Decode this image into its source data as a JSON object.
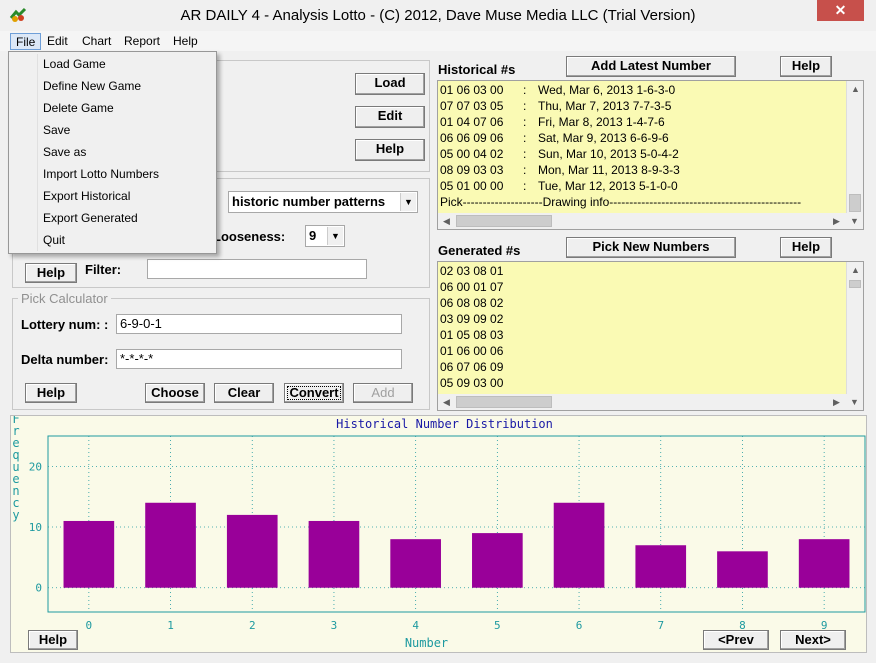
{
  "window": {
    "title": "AR DAILY 4 - Analysis Lotto - (C) 2012, Dave Muse Media LLC (Trial Version)",
    "close_glyph": "✕"
  },
  "menubar": {
    "items": [
      "File",
      "Edit",
      "Chart",
      "Report",
      "Help"
    ]
  },
  "file_menu": {
    "items": [
      "Load Game",
      "Define New Game",
      "Delete Game",
      "Save",
      "Save as",
      "Import Lotto Numbers",
      "Export Historical",
      "Export Generated",
      "Quit"
    ]
  },
  "game_panel": {
    "load_label": "Load",
    "edit_label": "Edit",
    "help_label": "Help"
  },
  "pattern_panel": {
    "pattern_value": "historic number patterns",
    "looseness_label": "Looseness:",
    "looseness_value": "9",
    "help_label": "Help",
    "filter_label": "Filter:",
    "filter_value": ""
  },
  "pick_calculator": {
    "caption": "Pick Calculator",
    "lottery_label": "Lottery num: :",
    "lottery_value": "6-9-0-1",
    "delta_label": "Delta number:",
    "delta_value": "*-*-*-*",
    "help_label": "Help",
    "choose_label": "Choose",
    "clear_label": "Clear",
    "convert_label": "Convert",
    "add_label": "Add"
  },
  "historical": {
    "label": "Historical #s",
    "add_latest_label": "Add Latest Number",
    "help_label": "Help",
    "rows": [
      {
        "nums": "01 06 03 00",
        "sep": ":",
        "info": "Wed, Mar 6, 2013 1-6-3-0"
      },
      {
        "nums": "07 07 03 05",
        "sep": ":",
        "info": "Thu, Mar 7, 2013 7-7-3-5"
      },
      {
        "nums": "01 04 07 06",
        "sep": ":",
        "info": "Fri, Mar 8, 2013 1-4-7-6"
      },
      {
        "nums": "06 06 09 06",
        "sep": ":",
        "info": "Sat, Mar 9, 2013 6-6-9-6"
      },
      {
        "nums": "05 00 04 02",
        "sep": ":",
        "info": "Sun, Mar 10, 2013 5-0-4-2"
      },
      {
        "nums": "08 09 03 03",
        "sep": ":",
        "info": "Mon, Mar 11, 2013 8-9-3-3"
      },
      {
        "nums": "05 01 00 00",
        "sep": ":",
        "info": "Tue, Mar 12, 2013 5-1-0-0"
      }
    ],
    "footer": "Pick--------------------Drawing info------------------------------------------------"
  },
  "generated": {
    "label": "Generated #s",
    "pick_new_label": "Pick New Numbers",
    "help_label": "Help",
    "rows": [
      "02 03 08 01",
      "06 00 01 07",
      "06 08 08 02",
      "03 09 09 02",
      "01 05 08 03",
      "01 06 00 06",
      "06 07 06 09",
      "05 09 03 00"
    ]
  },
  "chart_panel": {
    "help_label": "Help",
    "prev_label": "<Prev",
    "next_label": "Next>"
  },
  "chart_data": {
    "type": "bar",
    "title": "Historical Number Distribution",
    "xlabel": "Number",
    "ylabel": "Frequency",
    "categories": [
      "0",
      "1",
      "2",
      "3",
      "4",
      "5",
      "6",
      "7",
      "8",
      "9"
    ],
    "values": [
      11,
      14,
      12,
      11,
      8,
      9,
      14,
      7,
      6,
      8
    ],
    "yticks": [
      "0",
      "10",
      "20"
    ],
    "ylim": [
      -4,
      25
    ],
    "grid": true,
    "bar_color": "#990099",
    "axis_color": "#1e9aa0",
    "title_color": "#1a1aa6"
  }
}
